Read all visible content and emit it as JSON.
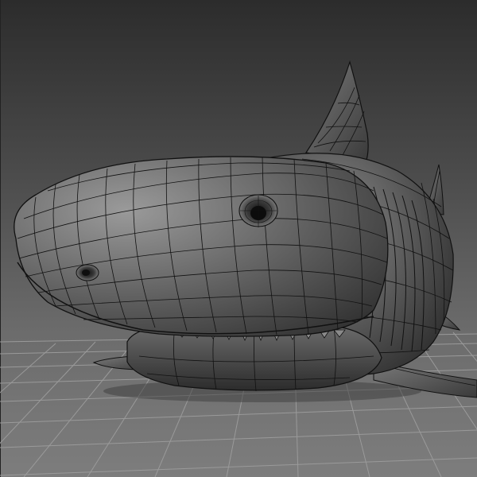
{
  "viewport": {
    "kind": "3d-modeling-viewport",
    "background_top": "#2c2c2c",
    "background_bottom": "#7d7d7d",
    "grid_color": "#9a9a9a",
    "wire_color": "#111111",
    "mesh_shade_light": "#8a8a8a",
    "mesh_shade_dark": "#2a2a2a",
    "model": "shark-wireframe-mesh"
  }
}
